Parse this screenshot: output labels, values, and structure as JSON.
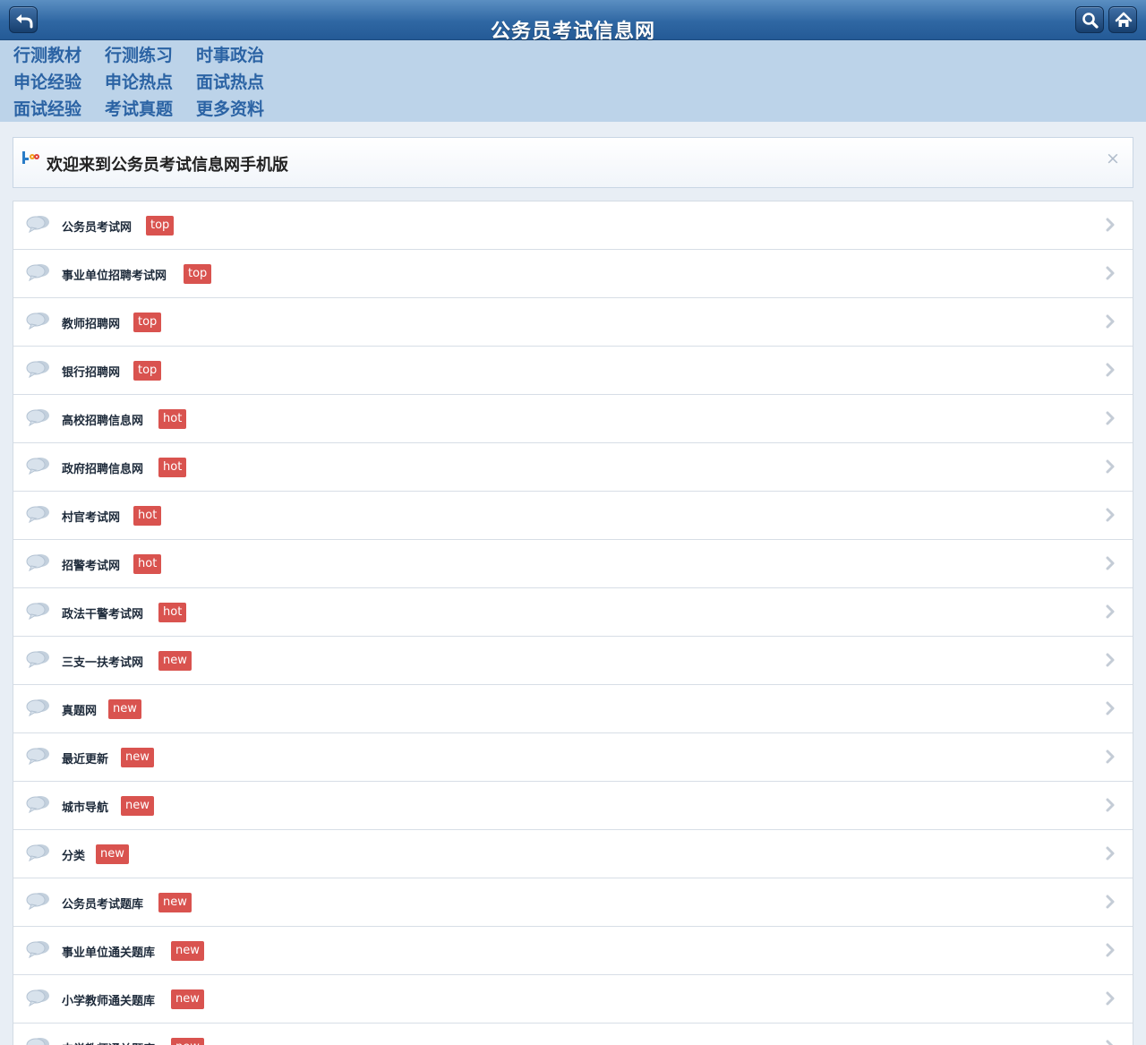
{
  "header": {
    "title": "公务员考试信息网",
    "back_icon": "back-arrow-icon",
    "search_icon": "search-icon",
    "home_icon": "home-icon"
  },
  "nav": {
    "links": [
      [
        "行测教材",
        "行测练习",
        "时事政治"
      ],
      [
        "申论经验",
        "申论热点",
        "面试热点"
      ],
      [
        "面试经验",
        "考试真题",
        "更多资料"
      ]
    ]
  },
  "welcome": {
    "text": "欢迎来到公务员考试信息网手机版",
    "close": "×"
  },
  "list": {
    "items": [
      {
        "label": "公务员考试网",
        "badge": "top"
      },
      {
        "label": "事业单位招聘考试网",
        "badge": "top"
      },
      {
        "label": "教师招聘网",
        "badge": "top"
      },
      {
        "label": "银行招聘网",
        "badge": "top"
      },
      {
        "label": "高校招聘信息网",
        "badge": "hot"
      },
      {
        "label": "政府招聘信息网",
        "badge": "hot"
      },
      {
        "label": "村官考试网",
        "badge": "hot"
      },
      {
        "label": "招警考试网",
        "badge": "hot"
      },
      {
        "label": "政法干警考试网",
        "badge": "hot"
      },
      {
        "label": "三支一扶考试网",
        "badge": "new"
      },
      {
        "label": "真题网",
        "badge": "new"
      },
      {
        "label": "最近更新",
        "badge": "new"
      },
      {
        "label": "城市导航",
        "badge": "new"
      },
      {
        "label": "分类",
        "badge": "new"
      },
      {
        "label": "公务员考试题库",
        "badge": "new"
      },
      {
        "label": "事业单位通关题库",
        "badge": "new"
      },
      {
        "label": "小学教师通关题库",
        "badge": "new"
      },
      {
        "label": "中学教师通关题库",
        "badge": "new"
      }
    ]
  }
}
